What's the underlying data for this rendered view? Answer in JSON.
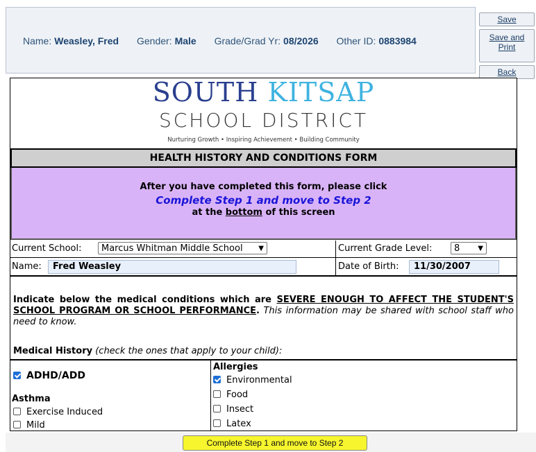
{
  "header": {
    "name_label": "Name:",
    "name_value": "Weasley, Fred",
    "gender_label": "Gender:",
    "gender_value": "Male",
    "grade_label": "Grade/Grad Yr:",
    "grade_value": "08/2026",
    "otherid_label": "Other ID:",
    "otherid_value": "0883984"
  },
  "buttons": {
    "save": "Save",
    "save_print_1": "Save and",
    "save_print_2": "Print",
    "back": "Back",
    "complete": "Complete Step 1 and move to Step 2"
  },
  "logo": {
    "south": "SOUTH",
    "kitsap": "KITSAP",
    "sub": "SCHOOL DISTRICT",
    "tagline": "Nurturing Growth • Inspiring Achievement • Building Community"
  },
  "form": {
    "title": "HEALTH HISTORY AND CONDITIONS FORM",
    "notice_line1": "After you have completed this form, please click",
    "notice_line2": "Complete Step 1 and move to Step 2",
    "notice_line3_pre": "at the ",
    "notice_line3_u": "bottom",
    "notice_line3_post": " of this screen",
    "current_school_label": "Current School:",
    "current_school_value": "Marcus Whitman Middle School",
    "current_grade_label": "Current Grade Level:",
    "current_grade_value": "8",
    "name_label": "Name:",
    "name_value": "Fred Weasley",
    "dob_label": "Date of Birth:",
    "dob_value": "11/30/2007",
    "indicate_pre": "Indicate below the medical conditions which are ",
    "indicate_u": "SEVERE ENOUGH TO AFFECT THE STUDENT'S SCHOOL PROGRAM OR SCHOOL PERFORMANCE",
    "indicate_dot": ".",
    "indicate_italic": " This information may be shared with school staff who need to know.",
    "medhist_bold": "Medical History",
    "medhist_italic": " (check the ones that apply to your child):"
  },
  "conditions": {
    "adhd": {
      "label": "ADHD/ADD",
      "checked": true
    },
    "asthma_heading": "Asthma",
    "exercise_induced": {
      "label": "Exercise Induced",
      "checked": false
    },
    "mild": {
      "label": "Mild",
      "checked": false
    },
    "allergies_heading": "Allergies",
    "environmental": {
      "label": "Environmental",
      "checked": true
    },
    "food": {
      "label": "Food",
      "checked": false
    },
    "insect": {
      "label": "Insect",
      "checked": false
    },
    "latex": {
      "label": "Latex",
      "checked": false
    }
  }
}
